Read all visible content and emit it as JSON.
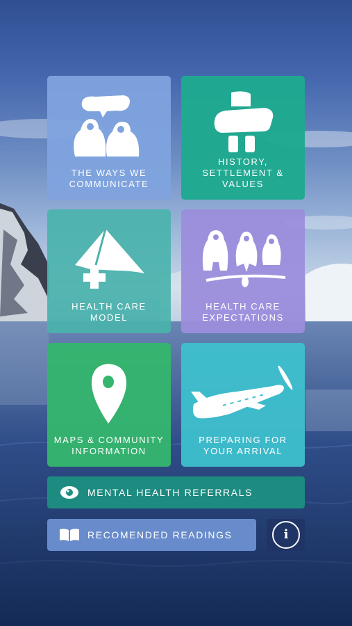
{
  "tiles": {
    "communicate": {
      "label": "THE WAYS WE COMMUNICATE",
      "icon": "two-people-speech-icon",
      "color": "#7fa3de"
    },
    "history": {
      "label": "HISTORY, SETTLEMENT & VALUES",
      "icon": "inukshuk-icon",
      "color": "#1fa98f"
    },
    "health_model": {
      "label": "HEALTH CARE MODEL",
      "icon": "tent-plus-icon",
      "color": "#4bb3ac"
    },
    "health_expect": {
      "label": "HEALTH CARE EXPECTATIONS",
      "icon": "three-figures-icon",
      "color": "#9c8ddc"
    },
    "maps": {
      "label": "MAPS & COMMUNITY INFORMATION",
      "icon": "map-pin-icon",
      "color": "#35b56d"
    },
    "arrival": {
      "label": "PREPARING FOR YOUR ARRIVAL",
      "icon": "airplane-icon",
      "color": "#3ec0cd"
    }
  },
  "bars": {
    "mental_health": {
      "label": "MENTAL HEALTH REFERRALS",
      "icon": "eye-icon",
      "color": "#1e8f82"
    },
    "readings": {
      "label": "RECOMENDED READINGS",
      "icon": "open-book-icon",
      "color": "#6b8fcf"
    }
  },
  "info": {
    "glyph": "i",
    "icon": "info-icon"
  }
}
